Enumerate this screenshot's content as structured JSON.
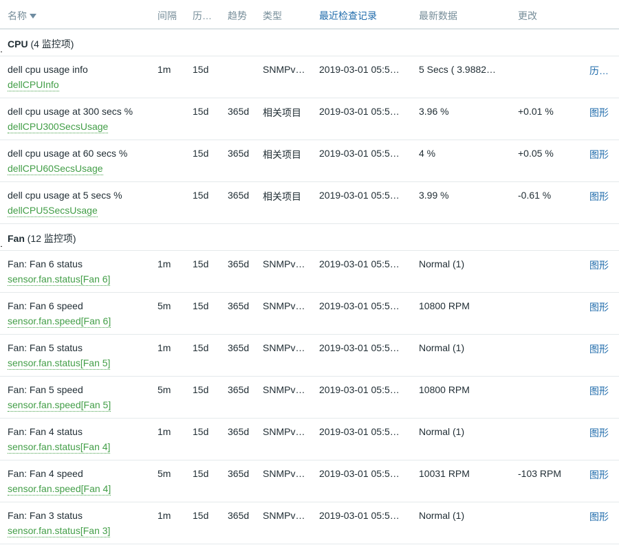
{
  "header": {
    "name": "名称",
    "interval": "间隔",
    "history": "历…",
    "trends": "趋势",
    "type": "类型",
    "last_check": "最近检查记录",
    "last_value": "最新数据",
    "change": "更改"
  },
  "groups": [
    {
      "name": "CPU",
      "count": "(4 监控项)",
      "rows": [
        {
          "name": "dell cpu usage info",
          "key": "dellCPUInfo",
          "interval": "1m",
          "history": "15d",
          "trends": "",
          "type": "SNMPv…",
          "last_check": "2019-03-01 05:5…",
          "last_value": "5 Secs ( 3.9882…",
          "change": "",
          "link": "历…"
        },
        {
          "name": "dell cpu usage at 300 secs %",
          "key": "dellCPU300SecsUsage",
          "interval": "",
          "history": "15d",
          "trends": "365d",
          "type": "相关项目",
          "last_check": "2019-03-01 05:5…",
          "last_value": "3.96 %",
          "change": "+0.01 %",
          "link": "图形"
        },
        {
          "name": "dell cpu usage at 60 secs %",
          "key": "dellCPU60SecsUsage",
          "interval": "",
          "history": "15d",
          "trends": "365d",
          "type": "相关项目",
          "last_check": "2019-03-01 05:5…",
          "last_value": "4 %",
          "change": "+0.05 %",
          "link": "图形"
        },
        {
          "name": "dell cpu usage at 5 secs %",
          "key": "dellCPU5SecsUsage",
          "interval": "",
          "history": "15d",
          "trends": "365d",
          "type": "相关项目",
          "last_check": "2019-03-01 05:5…",
          "last_value": "3.99 %",
          "change": "-0.61 %",
          "link": "图形"
        }
      ]
    },
    {
      "name": "Fan",
      "count": "(12 监控项)",
      "rows": [
        {
          "name": "Fan: Fan 6 status",
          "key": "sensor.fan.status[Fan 6]",
          "interval": "1m",
          "history": "15d",
          "trends": "365d",
          "type": "SNMPv…",
          "last_check": "2019-03-01 05:5…",
          "last_value": "Normal (1)",
          "change": "",
          "link": "图形"
        },
        {
          "name": "Fan: Fan 6 speed",
          "key": "sensor.fan.speed[Fan 6]",
          "interval": "5m",
          "history": "15d",
          "trends": "365d",
          "type": "SNMPv…",
          "last_check": "2019-03-01 05:5…",
          "last_value": "10800 RPM",
          "change": "",
          "link": "图形"
        },
        {
          "name": "Fan: Fan 5 status",
          "key": "sensor.fan.status[Fan 5]",
          "interval": "1m",
          "history": "15d",
          "trends": "365d",
          "type": "SNMPv…",
          "last_check": "2019-03-01 05:5…",
          "last_value": "Normal (1)",
          "change": "",
          "link": "图形"
        },
        {
          "name": "Fan: Fan 5 speed",
          "key": "sensor.fan.speed[Fan 5]",
          "interval": "5m",
          "history": "15d",
          "trends": "365d",
          "type": "SNMPv…",
          "last_check": "2019-03-01 05:5…",
          "last_value": "10800 RPM",
          "change": "",
          "link": "图形"
        },
        {
          "name": "Fan: Fan 4 status",
          "key": "sensor.fan.status[Fan 4]",
          "interval": "1m",
          "history": "15d",
          "trends": "365d",
          "type": "SNMPv…",
          "last_check": "2019-03-01 05:5…",
          "last_value": "Normal (1)",
          "change": "",
          "link": "图形"
        },
        {
          "name": "Fan: Fan 4 speed",
          "key": "sensor.fan.speed[Fan 4]",
          "interval": "5m",
          "history": "15d",
          "trends": "365d",
          "type": "SNMPv…",
          "last_check": "2019-03-01 05:5…",
          "last_value": "10031 RPM",
          "change": "-103 RPM",
          "link": "图形"
        },
        {
          "name": "Fan: Fan 3 status",
          "key": "sensor.fan.status[Fan 3]",
          "interval": "1m",
          "history": "15d",
          "trends": "365d",
          "type": "SNMPv…",
          "last_check": "2019-03-01 05:5…",
          "last_value": "Normal (1)",
          "change": "",
          "link": "图形"
        }
      ]
    }
  ]
}
